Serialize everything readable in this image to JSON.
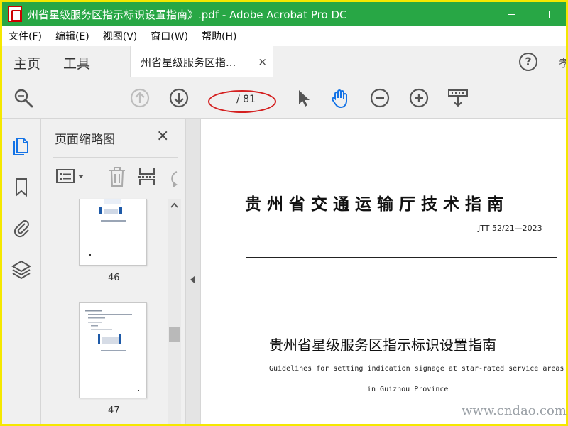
{
  "window": {
    "title": "州省星级服务区指示标识设置指南》.pdf - Adobe Acrobat Pro DC"
  },
  "menu": [
    "文件(F)",
    "编辑(E)",
    "视图(V)",
    "窗口(W)",
    "帮助(H)"
  ],
  "tabs": {
    "home": "主页",
    "tools": "工具",
    "document": "州省星级服务区指...",
    "close_glyph": "×",
    "help_glyph": "?",
    "extra_glyph": "孝"
  },
  "toolbar": {
    "current_page": "",
    "total_pages": "/ 81"
  },
  "thumbnails": {
    "title": "页面缩略图",
    "close_glyph": "×",
    "pages": [
      {
        "number": "46"
      },
      {
        "number": "47"
      }
    ]
  },
  "document": {
    "header_title": "贵州省交通运输厅技术指南",
    "code": "JTT 52/21—2023",
    "main_title": "贵州省星级服务区指示标识设置指南",
    "subtitle_en_1": "Guidelines for setting indication signage at star-rated service areas",
    "subtitle_en_2": "in Guizhou Province"
  },
  "watermark": "www.cndao.com",
  "colors": {
    "titlebar": "#28a745",
    "hand_tool_active": "#1473e6",
    "annotation_red": "#d42020"
  }
}
